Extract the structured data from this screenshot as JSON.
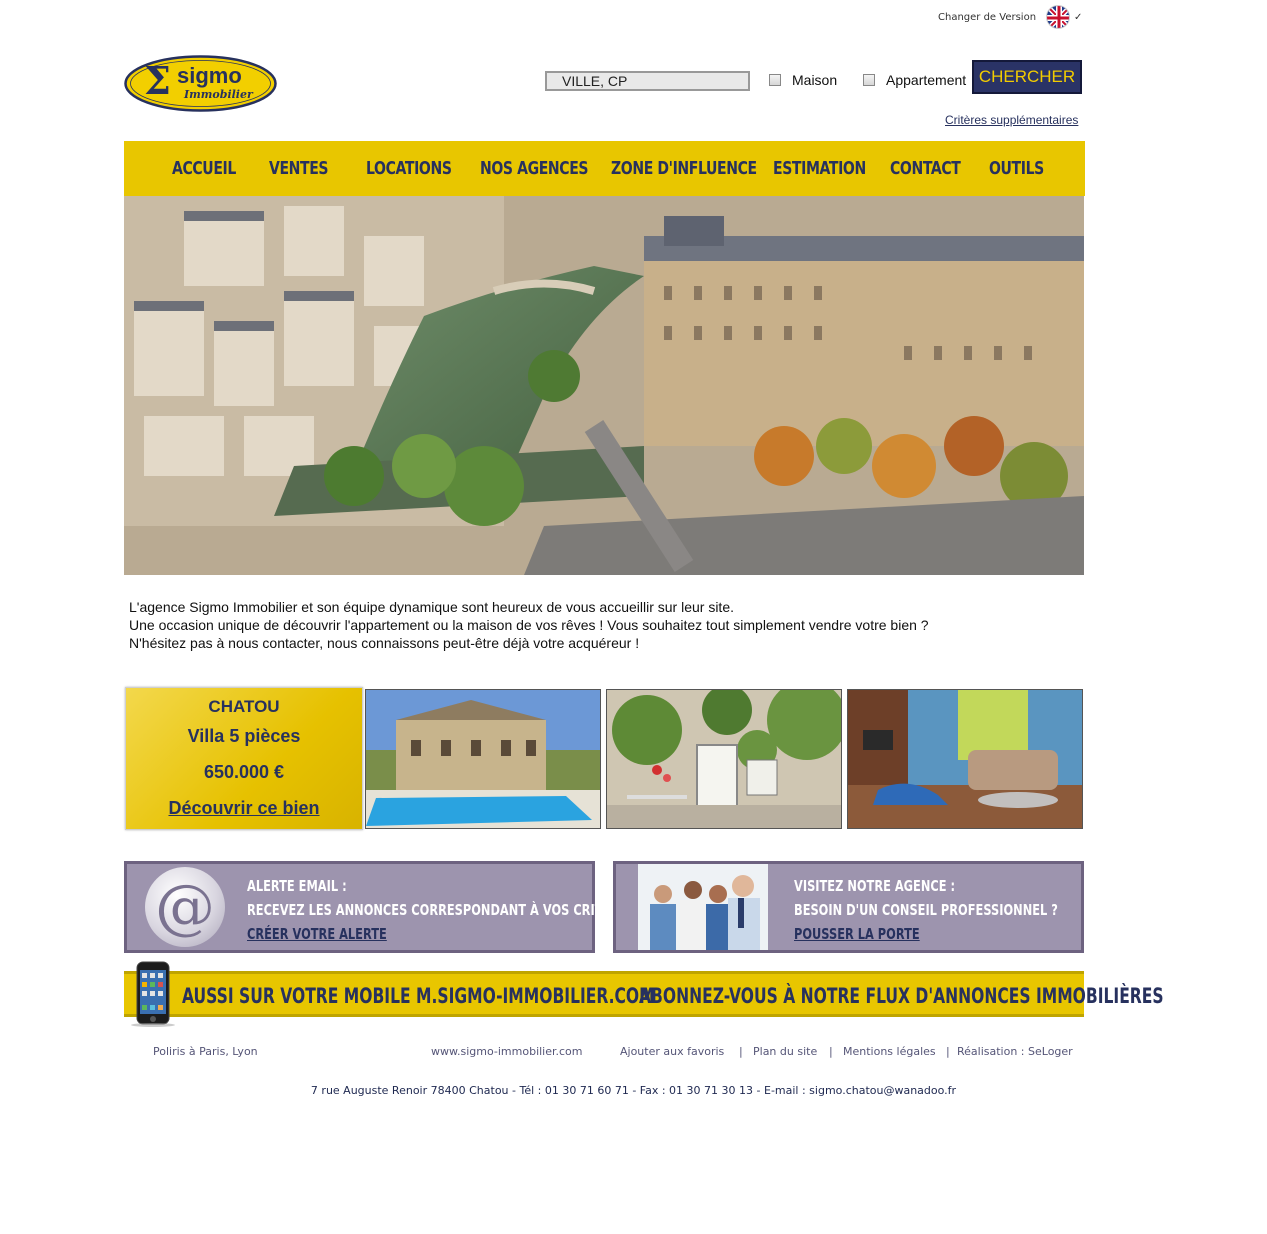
{
  "header": {
    "change_version_label": "Changer de Version",
    "flag_icon": "uk-flag-icon"
  },
  "logo": {
    "main": "sigmo",
    "sub": "Immobilier",
    "symbol": "Σ",
    "colors": {
      "yellow": "#f2cf00",
      "blue": "#27315e"
    }
  },
  "search": {
    "placeholder": "VILLE, CP",
    "value": "VILLE, CP",
    "checkbox_house_label": "Maison",
    "checkbox_apartment_label": "Appartement",
    "button_label": "CHERCHER",
    "more_criteria_label": "Critères supplémentaires"
  },
  "nav": {
    "items": [
      {
        "label": "ACCUEIL"
      },
      {
        "label": "VENTES"
      },
      {
        "label": "LOCATIONS"
      },
      {
        "label": "NOS AGENCES"
      },
      {
        "label": "ZONE D'INFLUENCE"
      },
      {
        "label": "ESTIMATION"
      },
      {
        "label": "CONTACT"
      },
      {
        "label": "OUTILS"
      }
    ]
  },
  "intro": {
    "line1": "L'agence Sigmo Immobilier et son équipe dynamique sont heureux de vous accueillir sur leur site.",
    "line2": "Une occasion unique de découvrir l'appartement ou la maison de vos rêves ! Vous souhaitez tout simplement vendre votre bien ?",
    "line3": "N'hésitez pas à nous contacter, nous connaissons peut-être déjà votre acquéreur !"
  },
  "featured": {
    "city": "CHATOU",
    "type": "Villa 5 pièces",
    "price": "650.000 €",
    "link": "Découvrir ce bien"
  },
  "promos": {
    "alert": {
      "title": "ALERTE EMAIL :",
      "text": "RECEVEZ LES ANNONCES CORRESPONDANT À VOS CRITÈRES",
      "link": "CRÉER VOTRE ALERTE"
    },
    "agency": {
      "title": "VISITEZ NOTRE AGENCE :",
      "text": "BESOIN D'UN CONSEIL PROFESSIONNEL ?",
      "link": "POUSSER LA PORTE"
    }
  },
  "banner": {
    "mobile": "AUSSI SUR VOTRE  MOBILE M.SIGMO-IMMOBILIER.COM",
    "feed": "ABONNEZ-VOUS À NOTRE FLUX D'ANNONCES IMMOBILIÈRES"
  },
  "footer": {
    "cities": "Poliris à Paris, Lyon",
    "website": "www.sigmo-immobilier.com",
    "favorites": "Ajouter aux favoris",
    "sitemap": "Plan du site",
    "legal": "Mentions légales",
    "credit": "Réalisation : SeLoger",
    "separator": "|",
    "address": "7 rue Auguste Renoir 78400 Chatou  -  Tél : 01 30 71 60 71 - Fax : 01 30 71 30 13 - E-mail : sigmo.chatou@wanadoo.fr"
  },
  "colors": {
    "nav_yellow": "#e8c600",
    "navy": "#27315e",
    "promo_purple": "#9d94ae"
  }
}
